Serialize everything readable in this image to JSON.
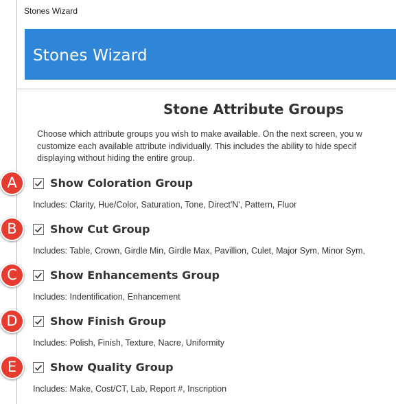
{
  "window": {
    "title": "Stones Wizard"
  },
  "banner": {
    "title": "Stones Wizard"
  },
  "page": {
    "heading": "Stone Attribute Groups",
    "intro_lines": [
      "Choose which attribute groups you wish to make available.  On the next screen, you w",
      "customize each available attribute individually.  This includes the ability to hide specif",
      "displaying without hiding the entire group."
    ]
  },
  "groups": [
    {
      "badge": "A",
      "label": "Show Coloration Group",
      "checked": true,
      "includes": "Includes: Clarity, Hue/Color, Saturation, Tone, Direct'N', Pattern, Fluor"
    },
    {
      "badge": "B",
      "label": "Show Cut Group",
      "checked": true,
      "includes": "Includes: Table, Crown, Girdle Min, Girdle Max, Pavillion, Culet, Major Sym, Minor Sym,"
    },
    {
      "badge": "C",
      "label": "Show Enhancements Group",
      "checked": true,
      "includes": "Includes: Indentification, Enhancement"
    },
    {
      "badge": "D",
      "label": "Show Finish Group",
      "checked": true,
      "includes": "Includes: Polish, Finish, Texture, Nacre, Uniformity"
    },
    {
      "badge": "E",
      "label": "Show Quality Group",
      "checked": true,
      "includes": "Includes: Make, Cost/CT, Lab, Report #, Inscription"
    }
  ],
  "colors": {
    "banner": "#2f85d8",
    "badge": "#e63b2f",
    "text": "#333333"
  },
  "icons": {
    "checkbox_mark": "check-icon"
  }
}
